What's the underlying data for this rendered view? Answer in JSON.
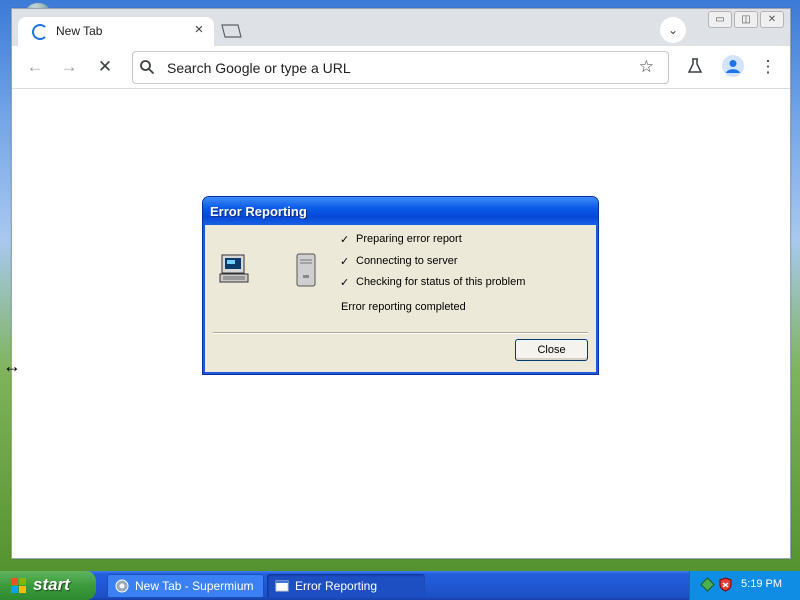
{
  "browser": {
    "tab": {
      "title": "New Tab"
    },
    "omnibox": {
      "placeholder": "Search Google or type a URL"
    }
  },
  "dialog": {
    "title": "Error Reporting",
    "steps": [
      "Preparing error report",
      "Connecting to server",
      "Checking for status of this problem"
    ],
    "status": "Error reporting completed",
    "close_label": "Close",
    "check_mark": "✓"
  },
  "taskbar": {
    "start_label": "start",
    "tasks": [
      {
        "label": "New Tab - Supermium"
      },
      {
        "label": "Error Reporting"
      }
    ],
    "clock": "5:19 PM"
  },
  "colors": {
    "xp_blue": "#0a5ae8",
    "dialog_bg": "#ece9d8",
    "start_green": "#3c9a3c",
    "chrome_accent": "#1a73e8"
  }
}
